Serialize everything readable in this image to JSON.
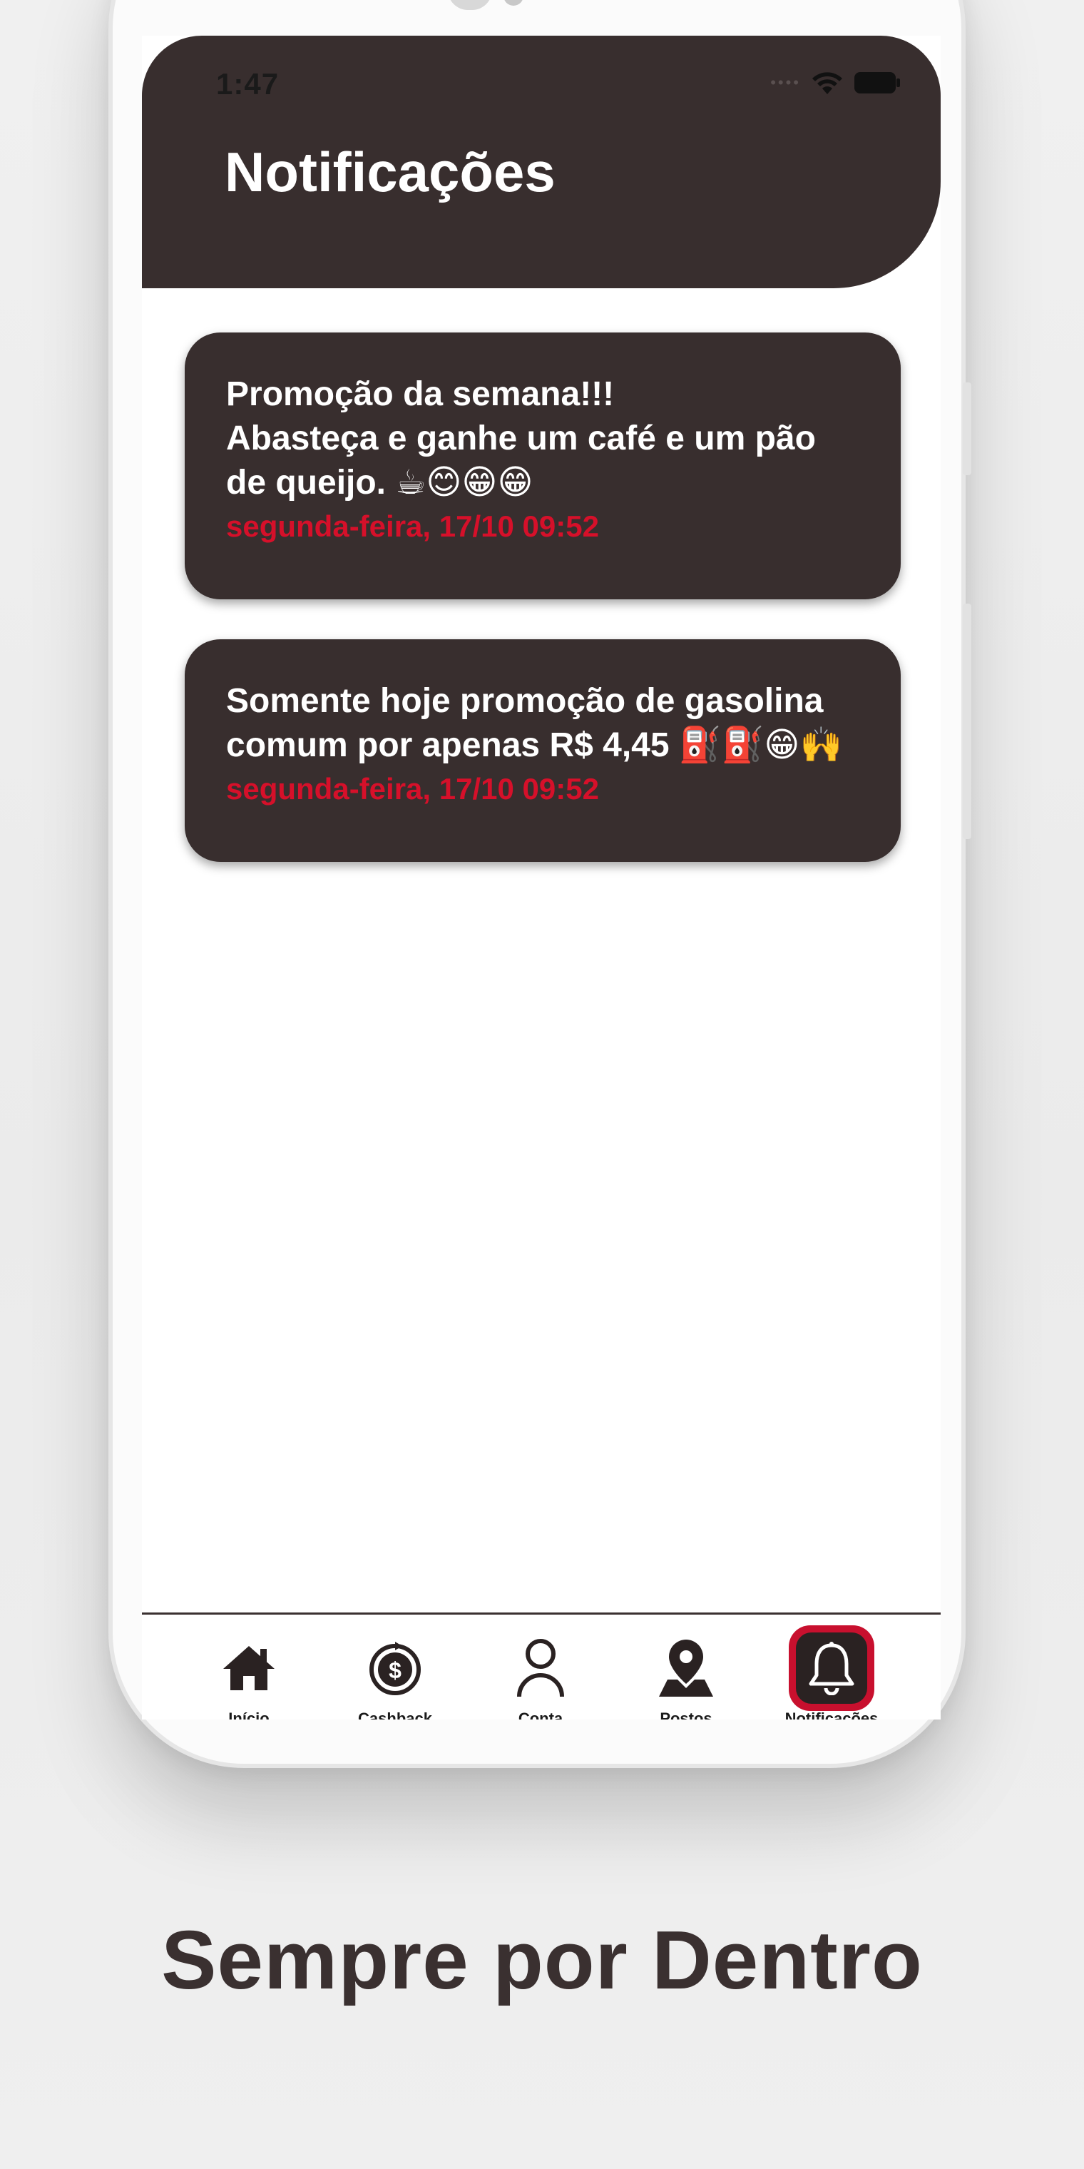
{
  "status_bar": {
    "time": "1:47"
  },
  "header": {
    "title": "Notificações"
  },
  "notifications": [
    {
      "text": "Promoção da semana!!!\nAbasteça e ganhe um café e um pão\nde queijo. ☕😊😁😁",
      "date": "segunda-feira, 17/10 09:52"
    },
    {
      "text": "Somente hoje promoção de gasolina\ncomum por apenas R$ 4,45 ⛽⛽😁🙌",
      "date": "segunda-feira, 17/10 09:52"
    }
  ],
  "tabbar": {
    "items": [
      {
        "label": "Início",
        "icon": "home-icon"
      },
      {
        "label": "Cashback",
        "icon": "cashback-icon"
      },
      {
        "label": "Conta",
        "icon": "user-icon"
      },
      {
        "label": "Postos",
        "icon": "location-icon"
      },
      {
        "label": "Notificações",
        "icon": "bell-icon",
        "active": true
      }
    ]
  },
  "tagline": "Sempre por Dentro",
  "colors": {
    "header_bg": "#382e2e",
    "card_bg": "#382e2e",
    "date_red": "#d6102a",
    "active_tab_ring": "#c8102e"
  }
}
